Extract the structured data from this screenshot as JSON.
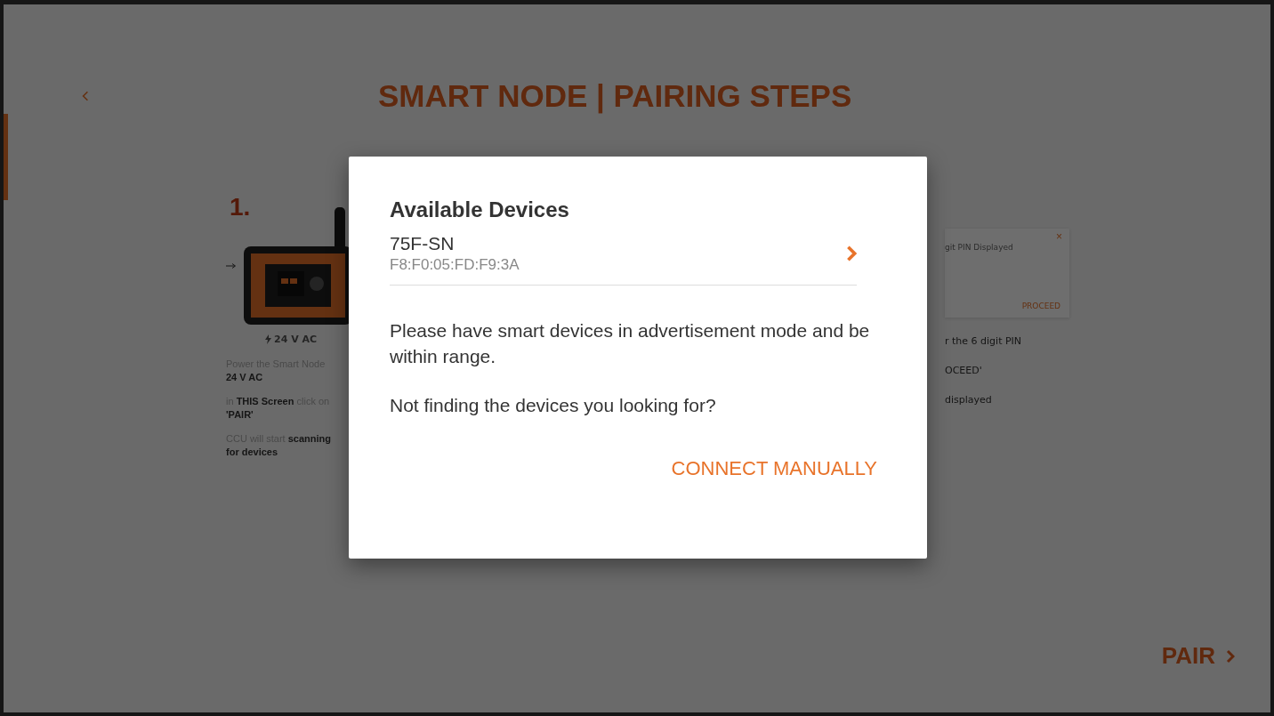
{
  "header": {
    "title": "SMART NODE | PAIRING STEPS"
  },
  "steps": [
    {
      "number": "1.",
      "power_label": "24 V AC",
      "instructions": [
        [
          "Power the Smart Node",
          "**24 V AC**"
        ],
        [
          "in **THIS Screen** click on",
          "**'PAIR'**"
        ],
        [
          "CCU will start **scanning**",
          "**for devices**"
        ]
      ]
    }
  ],
  "pin_card": {
    "text": "git PIN Displayed",
    "close": "×",
    "action": "PROCEED"
  },
  "pin_instructions": [
    "r the 6 digit PIN",
    "OCEED'",
    "displayed"
  ],
  "pair_button": {
    "label": "PAIR"
  },
  "dialog": {
    "title": "Available Devices",
    "devices": [
      {
        "name": "75F-SN",
        "address": "F8:F0:05:FD:F9:3A"
      }
    ],
    "messages": [
      "Please have smart devices in advertisement mode and be within range.",
      "Not finding the devices you looking for?"
    ],
    "action": "CONNECT MANUALLY"
  }
}
